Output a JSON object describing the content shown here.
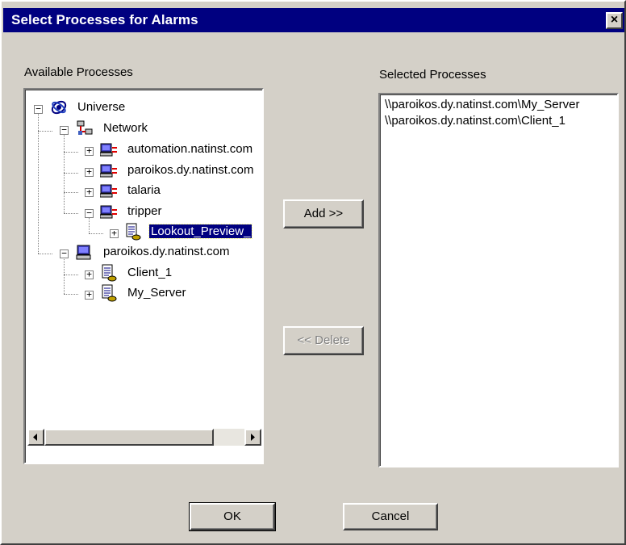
{
  "window": {
    "title": "Select Processes for Alarms",
    "close_label": "×"
  },
  "available": {
    "label": "Available Processes",
    "tree": [
      {
        "label": "Universe",
        "icon": "globe-icon",
        "expander": "−"
      },
      {
        "label": "Network",
        "icon": "network-icon",
        "expander": "−"
      },
      {
        "label": "automation.natinst.com",
        "icon": "computer-icon",
        "expander": "+"
      },
      {
        "label": "paroikos.dy.natinst.com",
        "icon": "computer-icon",
        "expander": "+"
      },
      {
        "label": "talaria",
        "icon": "computer-icon",
        "expander": "+"
      },
      {
        "label": "tripper",
        "icon": "computer-icon",
        "expander": "−"
      },
      {
        "label": "Lookout_Preview_",
        "icon": "process-document-icon",
        "expander": "+"
      },
      {
        "label": "paroikos.dy.natinst.com",
        "icon": "local-computer-icon",
        "expander": "−"
      },
      {
        "label": "Client_1",
        "icon": "process-document-icon",
        "expander": "+"
      },
      {
        "label": "My_Server",
        "icon": "process-document-icon",
        "expander": "+"
      }
    ],
    "scroll_left": "◀",
    "scroll_right": "▶"
  },
  "selected": {
    "label": "Selected Processes",
    "items": [
      "\\\\paroikos.dy.natinst.com\\My_Server",
      "\\\\paroikos.dy.natinst.com\\Client_1"
    ]
  },
  "buttons": {
    "add": "Add >>",
    "delete": "<< Delete",
    "ok": "OK",
    "cancel": "Cancel"
  },
  "colors": {
    "titlebar": "#000080",
    "face": "#d4d0c8",
    "selection": "#000080"
  }
}
